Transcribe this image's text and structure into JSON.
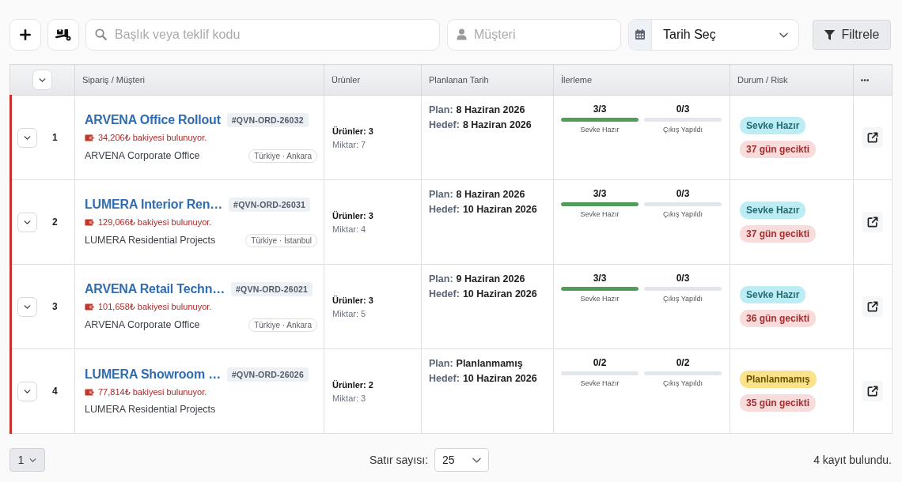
{
  "toolbar": {
    "search": {
      "placeholder": "Başlık veya teklif kodu"
    },
    "customer": {
      "placeholder": "Müşteri"
    },
    "date_picker": {
      "value": "Tarih Seç"
    },
    "filter_button": "Filtrele"
  },
  "table": {
    "columns": [
      "Sipariş / Müşteri",
      "Ürünler",
      "Planlanan Tarih",
      "İlerleme",
      "Durum / Risk"
    ],
    "rows": [
      {
        "number": "1",
        "overdue": true,
        "title": "ARVENA Office Rollout",
        "code": "#QVN-ORD-26032",
        "balance": "34,206₺ bakiyesi bulunuyor.",
        "customer": "ARVENA Corporate Office",
        "location": "Türkiye · Ankara",
        "products": "Ürünler: 3",
        "quantity": "Miktar: 7",
        "plan": {
          "label": "Plan:",
          "value": "8 Haziran 2026"
        },
        "target": {
          "label": "Hedef:",
          "value": "8 Haziran 2026"
        },
        "progress": [
          {
            "count": "3/3",
            "level": 1,
            "label": "Sevke Hazır"
          },
          {
            "count": "0/3",
            "level": 0,
            "label": "Çıkış Yapıldı"
          }
        ],
        "status": {
          "label": "Sevke Hazır",
          "kind": "ready"
        },
        "delay": "37 gün gecikti"
      },
      {
        "number": "2",
        "overdue": true,
        "title": "LUMERA Interior Ren…",
        "code": "#QVN-ORD-26031",
        "balance": "129,066₺ bakiyesi bulunuyor.",
        "customer": "LUMERA Residential Projects",
        "location": "Türkiye · İstanbul",
        "products": "Ürünler: 3",
        "quantity": "Miktar: 4",
        "plan": {
          "label": "Plan:",
          "value": "8 Haziran 2026"
        },
        "target": {
          "label": "Hedef:",
          "value": "10 Haziran 2026"
        },
        "progress": [
          {
            "count": "3/3",
            "level": 1,
            "label": "Sevke Hazır"
          },
          {
            "count": "0/3",
            "level": 0,
            "label": "Çıkış Yapıldı"
          }
        ],
        "status": {
          "label": "Sevke Hazır",
          "kind": "ready"
        },
        "delay": "37 gün gecikti"
      },
      {
        "number": "3",
        "overdue": true,
        "title": "ARVENA Retail Techn…",
        "code": "#QVN-ORD-26021",
        "balance": "101,658₺ bakiyesi bulunuyor.",
        "customer": "ARVENA Corporate Office",
        "location": "Türkiye · Ankara",
        "products": "Ürünler: 3",
        "quantity": "Miktar: 5",
        "plan": {
          "label": "Plan:",
          "value": "9 Haziran 2026"
        },
        "target": {
          "label": "Hedef:",
          "value": "10 Haziran 2026"
        },
        "progress": [
          {
            "count": "3/3",
            "level": 1,
            "label": "Sevke Hazır"
          },
          {
            "count": "0/3",
            "level": 0,
            "label": "Çıkış Yapıldı"
          }
        ],
        "status": {
          "label": "Sevke Hazır",
          "kind": "ready"
        },
        "delay": "36 gün gecikti"
      },
      {
        "number": "4",
        "overdue": true,
        "title": "LUMERA Showroom …",
        "code": "#QVN-ORD-26026",
        "balance": "77,814₺ bakiyesi bulunuyor.",
        "customer": "LUMERA Residential Projects",
        "products": "Ürünler: 2",
        "quantity": "Miktar: 3",
        "plan": {
          "label": "Plan:",
          "value": "Planlanmamış"
        },
        "target": {
          "label": "Hedef:",
          "value": "10 Haziran 2026"
        },
        "progress": [
          {
            "count": "0/2",
            "level": 0,
            "label": "Sevke Hazır"
          },
          {
            "count": "0/2",
            "level": 0,
            "label": "Çıkış Yapıldı"
          }
        ],
        "status": {
          "label": "Planlanmamış",
          "kind": "unplanned"
        },
        "delay": "35 gün gecikti"
      }
    ]
  },
  "footer": {
    "page": "1",
    "rows_per_page": {
      "label": "Satır sayısı:",
      "value": "25"
    },
    "record_count": "4 kayıt bulundu."
  }
}
